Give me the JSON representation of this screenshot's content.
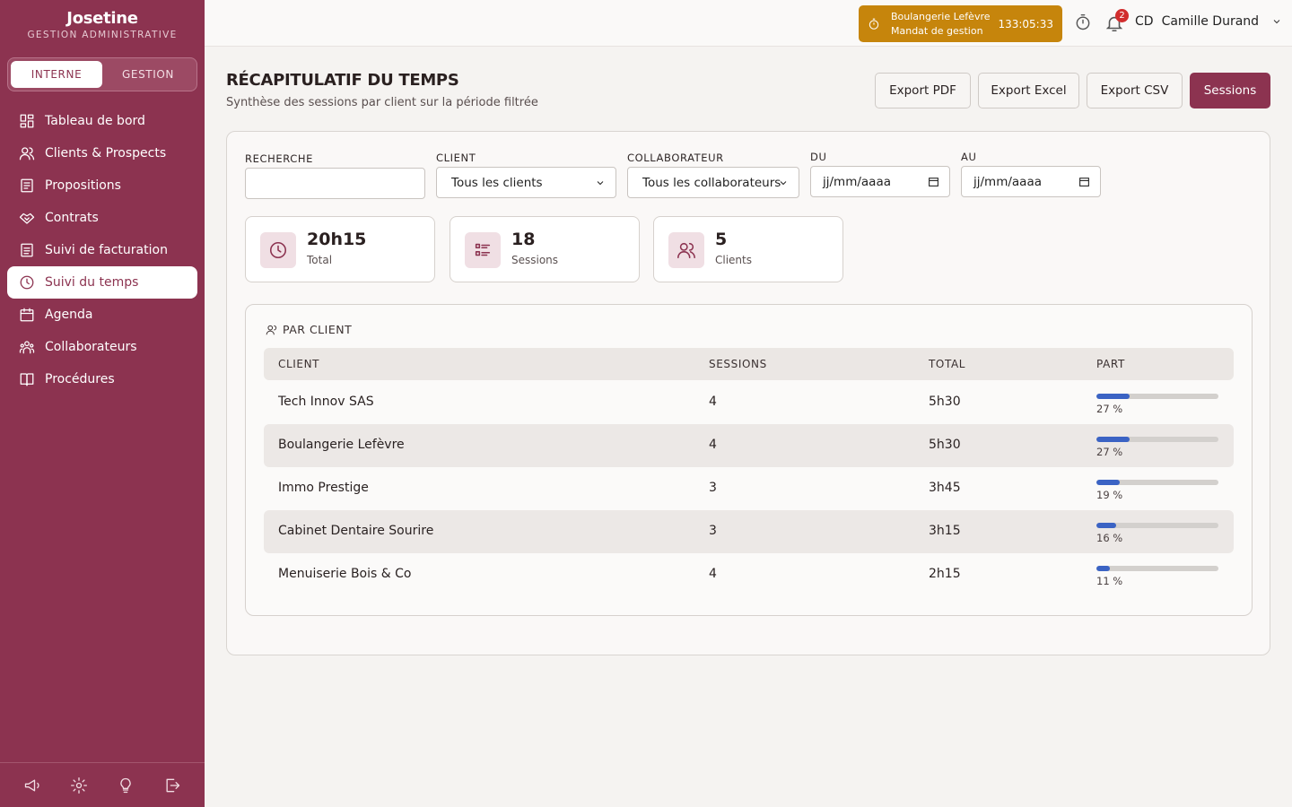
{
  "brand": {
    "name": "Josetine",
    "subtitle": "GESTION ADMINISTRATIVE"
  },
  "mode_switch": {
    "options": [
      "INTERNE",
      "GESTION"
    ],
    "active": "INTERNE"
  },
  "nav": [
    {
      "label": "Tableau de bord",
      "icon": "dashboard-icon"
    },
    {
      "label": "Clients & Prospects",
      "icon": "users-icon"
    },
    {
      "label": "Propositions",
      "icon": "document-icon"
    },
    {
      "label": "Contrats",
      "icon": "handshake-icon"
    },
    {
      "label": "Suivi de facturation",
      "icon": "invoice-icon"
    },
    {
      "label": "Suivi du temps",
      "icon": "clock-icon",
      "active": true
    },
    {
      "label": "Agenda",
      "icon": "calendar-icon"
    },
    {
      "label": "Collaborateurs",
      "icon": "team-icon"
    },
    {
      "label": "Procédures",
      "icon": "book-icon"
    }
  ],
  "footer_icons": [
    "megaphone-icon",
    "gear-icon",
    "lightbulb-icon",
    "logout-icon"
  ],
  "topbar": {
    "timer_client": "Boulangerie Lefèvre",
    "timer_task": "Mandat de gestion",
    "timer_time": "133:05:33",
    "notifications": "2",
    "user_initials": "CD",
    "user_name": "Camille Durand"
  },
  "header": {
    "title": "RÉCAPITULATIF DU TEMPS",
    "subtitle": "Synthèse des sessions par client sur la période filtrée",
    "buttons": [
      "Export PDF",
      "Export Excel",
      "Export CSV",
      "Sessions"
    ]
  },
  "filters": {
    "search_label": "RECHERCHE",
    "search_value": "",
    "client_label": "CLIENT",
    "client_value": "Tous les clients",
    "collab_label": "COLLABORATEUR",
    "collab_value": "Tous les collaborateurs",
    "from_label": "DU",
    "from_value": "jj/mm/aaaa",
    "to_label": "AU",
    "to_value": "jj/mm/aaaa"
  },
  "stats": [
    {
      "value": "20h15",
      "label": "Total",
      "icon": "clock-icon"
    },
    {
      "value": "18",
      "label": "Sessions",
      "icon": "list-icon"
    },
    {
      "value": "5",
      "label": "Clients",
      "icon": "users-icon"
    }
  ],
  "table": {
    "section_title": "PAR CLIENT",
    "columns": [
      "CLIENT",
      "SESSIONS",
      "TOTAL",
      "PART"
    ],
    "rows": [
      {
        "client": "Tech Innov SAS",
        "sessions": "4",
        "total": "5h30",
        "part": "27 %",
        "share": 0.27
      },
      {
        "client": "Boulangerie Lefèvre",
        "sessions": "4",
        "total": "5h30",
        "part": "27 %",
        "share": 0.27
      },
      {
        "client": "Immo Prestige",
        "sessions": "3",
        "total": "3h45",
        "part": "19 %",
        "share": 0.19
      },
      {
        "client": "Cabinet Dentaire Sourire",
        "sessions": "3",
        "total": "3h15",
        "part": "16 %",
        "share": 0.16
      },
      {
        "client": "Menuiserie Bois & Co",
        "sessions": "4",
        "total": "2h15",
        "part": "11 %",
        "share": 0.11
      }
    ]
  },
  "colors": {
    "brand": "#8c3350",
    "timer": "#c6850c",
    "progress": "#3b63c4"
  }
}
